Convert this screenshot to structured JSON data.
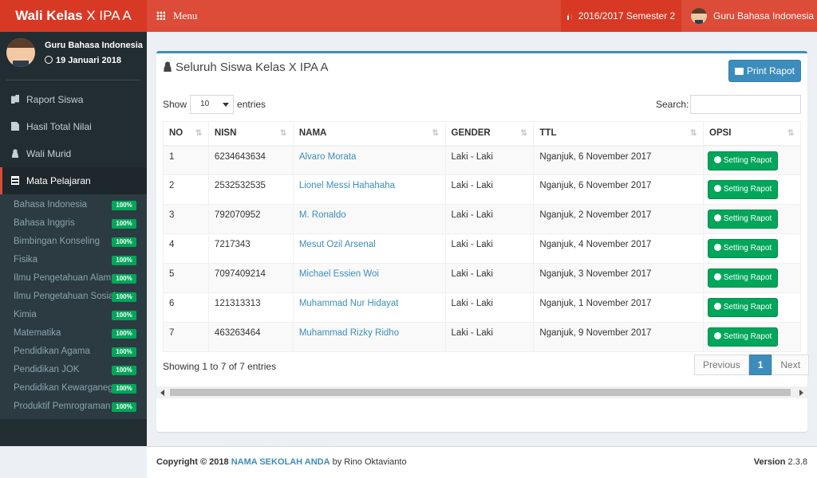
{
  "header": {
    "logo_bold": "Wali Kelas",
    "logo_rest": "X IPA A",
    "menu_label": "Menu",
    "semester": "2016/2017 Semester 2",
    "user": "Guru Bahasa Indonesia",
    "color": "#dd4b39"
  },
  "sidebar": {
    "user_name": "Guru Bahasa Indonesia",
    "date": "19 Januari 2018",
    "items": [
      {
        "label": "Raport Siswa",
        "icon": "copy-icon"
      },
      {
        "label": "Hasil Total Nilai",
        "icon": "file-icon"
      },
      {
        "label": "Wali Murid",
        "icon": "user-icon"
      },
      {
        "label": "Mata Pelajaran",
        "icon": "list-icon"
      }
    ],
    "subjects": [
      {
        "label": "Bahasa Indonesia",
        "badge": "100%"
      },
      {
        "label": "Bahasa Inggris",
        "badge": "100%"
      },
      {
        "label": "Bimbingan Konseling",
        "badge": "100%"
      },
      {
        "label": "Fisika",
        "badge": "100%"
      },
      {
        "label": "Ilmu Pengetahuan Alam",
        "badge": "100%"
      },
      {
        "label": "Ilmu Pengetahuan Sosial",
        "badge": "100%"
      },
      {
        "label": "Kimia",
        "badge": "100%"
      },
      {
        "label": "Matematika",
        "badge": "100%"
      },
      {
        "label": "Pendidikan Agama",
        "badge": "100%"
      },
      {
        "label": "Pendidikan JOK",
        "badge": "100%"
      },
      {
        "label": "Pendidikan Kewarganegaraan",
        "badge": "100%"
      },
      {
        "label": "Produktif Pemrograman",
        "badge": "100%"
      }
    ]
  },
  "box": {
    "title": "Seluruh Siswa Kelas X IPA A",
    "print_label": "Print Rapot",
    "show_label": "Show",
    "entries_value": "10",
    "entries_label": "entries",
    "search_label": "Search:",
    "columns": [
      "NO",
      "NISN",
      "NAMA",
      "GENDER",
      "TTL",
      "OPSI"
    ],
    "rows": [
      {
        "no": "1",
        "nisn": "6234643634",
        "nama": "Alvaro Morata",
        "gender": "Laki - Laki",
        "ttl": "Nganjuk, 6 November 2017",
        "opsi": "Setting Rapot"
      },
      {
        "no": "2",
        "nisn": "2532532535",
        "nama": "Lionel Messi Hahahaha",
        "gender": "Laki - Laki",
        "ttl": "Nganjuk, 6 November 2017",
        "opsi": "Setting Rapot"
      },
      {
        "no": "3",
        "nisn": "792070952",
        "nama": "M. Ronaldo",
        "gender": "Laki - Laki",
        "ttl": "Nganjuk, 2 November 2017",
        "opsi": "Setting Rapot"
      },
      {
        "no": "4",
        "nisn": "7217343",
        "nama": "Mesut Ozil Arsenal",
        "gender": "Laki - Laki",
        "ttl": "Nganjuk, 4 November 2017",
        "opsi": "Setting Rapot"
      },
      {
        "no": "5",
        "nisn": "7097409214",
        "nama": "Michael Essien Woi",
        "gender": "Laki - Laki",
        "ttl": "Nganjuk, 3 November 2017",
        "opsi": "Setting Rapot"
      },
      {
        "no": "6",
        "nisn": "121313313",
        "nama": "Muhammad Nur Hidayat",
        "gender": "Laki - Laki",
        "ttl": "Nganjuk, 1 November 2017",
        "opsi": "Setting Rapot"
      },
      {
        "no": "7",
        "nisn": "463263464",
        "nama": "Muhammad Rizky Ridho",
        "gender": "Laki - Laki",
        "ttl": "Nganjuk, 9 November 2017",
        "opsi": "Setting Rapot"
      }
    ],
    "info": "Showing 1 to 7 of 7 entries",
    "pager": {
      "prev": "Previous",
      "page": "1",
      "next": "Next"
    }
  },
  "footer": {
    "copyright": "Copyright © 2018",
    "school": "NAMA SEKOLAH ANDA",
    "by": "by Rino Oktavianto",
    "version_label": "Version",
    "version": "2.3.8"
  }
}
